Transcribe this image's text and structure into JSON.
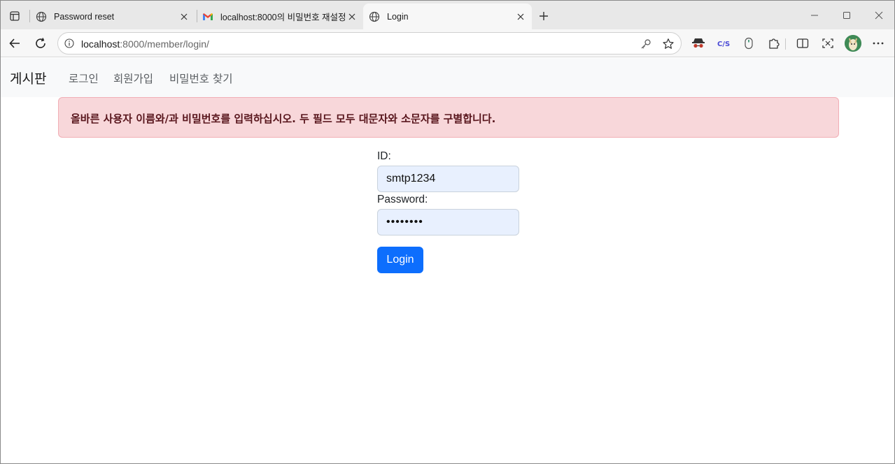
{
  "browser": {
    "tabs": [
      {
        "title": "Password reset",
        "icon": "globe-icon",
        "active": false
      },
      {
        "title": "localhost:8000의 비밀번호 재설정",
        "icon": "gmail-icon",
        "active": false
      },
      {
        "title": "Login",
        "icon": "globe-icon",
        "active": true
      }
    ],
    "url_host": "localhost",
    "url_rest": ":8000/member/login/"
  },
  "navbar": {
    "brand": "게시판",
    "links": [
      "로그인",
      "회원가입",
      "비밀번호 찾기"
    ]
  },
  "alert": {
    "message": "올바른 사용자 이름와/과 비밀번호를 입력하십시오. 두 필드 모두 대문자와 소문자를 구별합니다."
  },
  "form": {
    "id_label": "ID:",
    "id_value": "smtp1234",
    "password_label": "Password:",
    "password_value": "••••••••",
    "submit_label": "Login"
  },
  "colors": {
    "primary": "#0d6efd",
    "alert_bg": "#f8d7da",
    "alert_text": "#58151c",
    "autofill_bg": "#e8f0fe"
  }
}
